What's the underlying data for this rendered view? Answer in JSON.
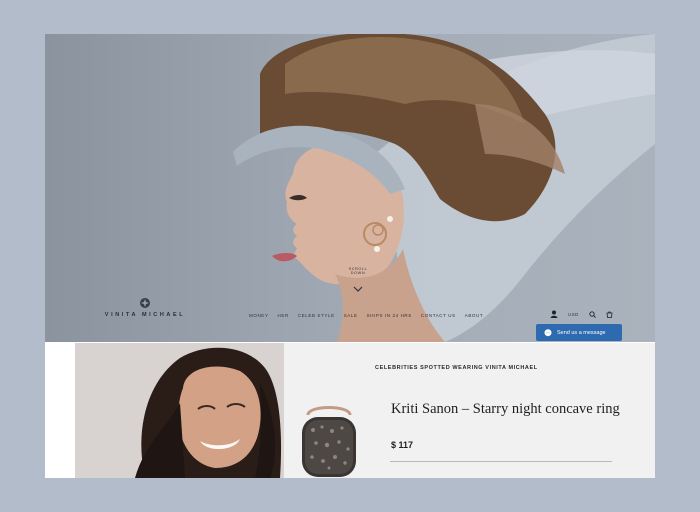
{
  "brand": {
    "name": "VINITA MICHAEL"
  },
  "nav": {
    "items": [
      "MONEY",
      "HER",
      "CELEB STYLE",
      "SALE",
      "SHIPS IN 24 HRS",
      "CONTACT US",
      "ABOUT"
    ]
  },
  "hero": {
    "scroll_label": "SCROLL DOWN"
  },
  "header": {
    "currency": "USD"
  },
  "messenger": {
    "label": "Send us a message"
  },
  "celebs": {
    "heading": "CELEBRITIES SPOTTED WEARING VINITA MICHAEL",
    "product_title": "Kriti Sanon – Starry night concave ring",
    "price": "$ 117"
  },
  "colors": {
    "page_bg": "#b2bccb",
    "messenger_blue": "#2e6ab0",
    "panel_bg": "#f1f1f1"
  },
  "icons": [
    "user-icon",
    "search-icon",
    "cart-icon",
    "chevron-down-icon",
    "messenger-icon",
    "logo-mark-icon"
  ]
}
